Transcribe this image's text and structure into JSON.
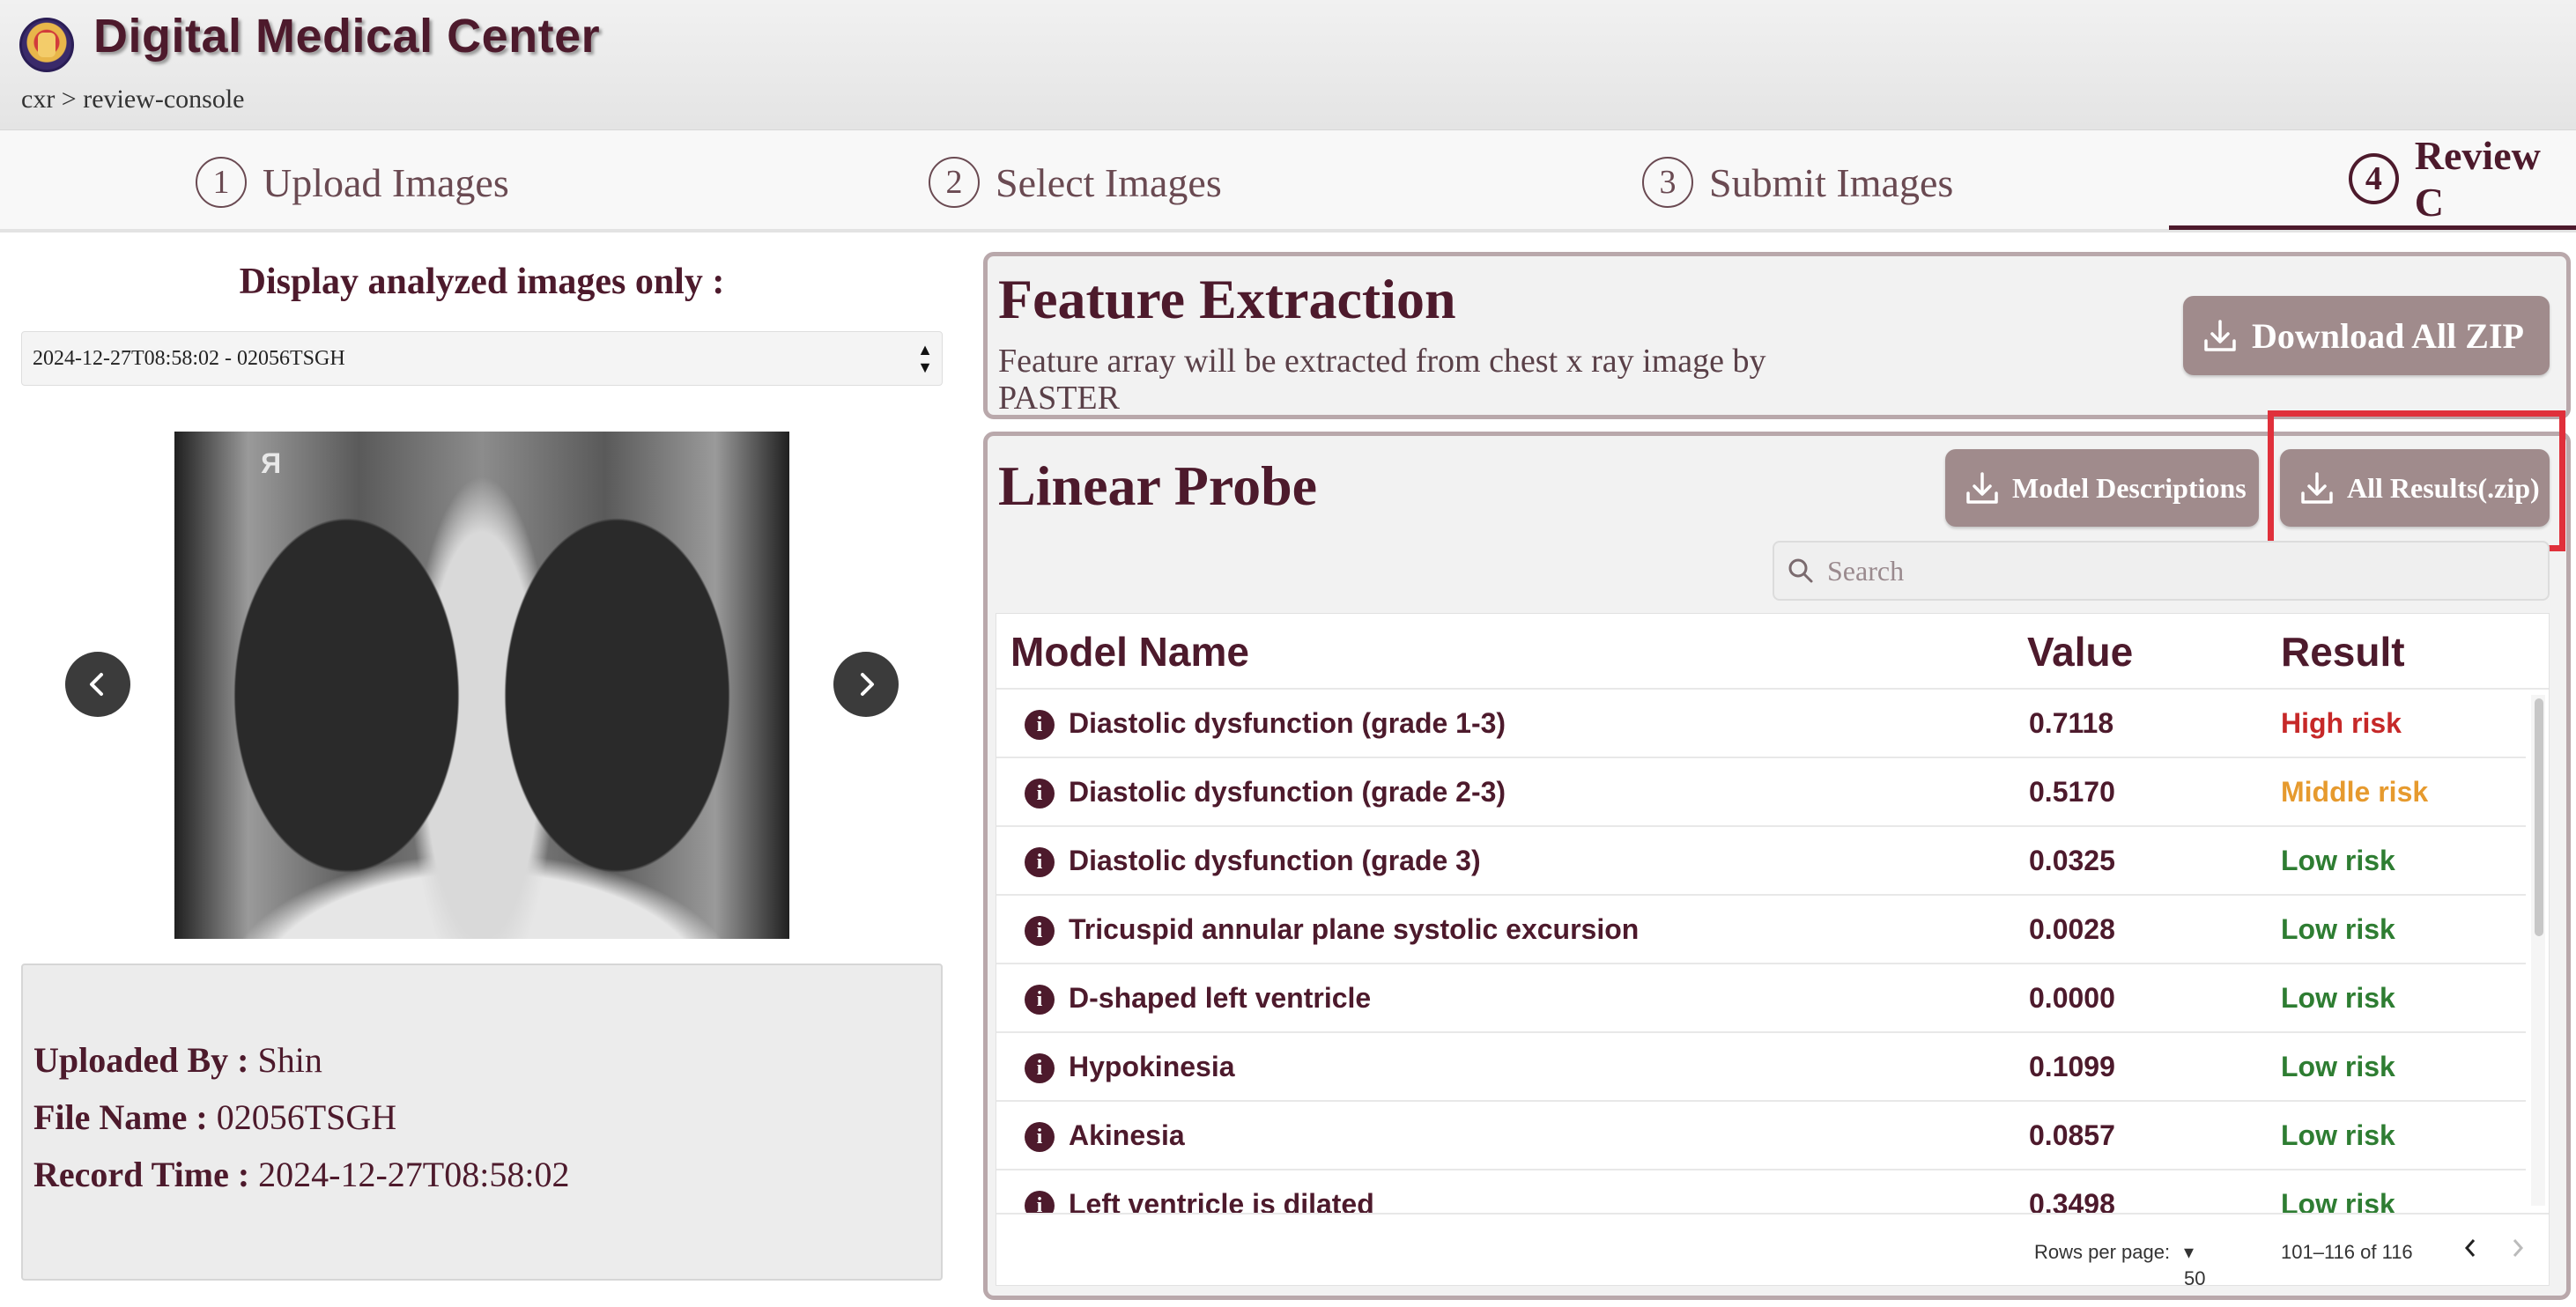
{
  "header": {
    "title": "Digital Medical Center",
    "breadcrumb": "cxr > review-console"
  },
  "stepper": {
    "steps": [
      {
        "num": "1",
        "label": "Upload Images"
      },
      {
        "num": "2",
        "label": "Select Images"
      },
      {
        "num": "3",
        "label": "Submit Images"
      },
      {
        "num": "4",
        "label": "Review C"
      }
    ],
    "active_step": 4
  },
  "left": {
    "filter_label": "Display analyzed images only :",
    "selected_record": "2024-12-27T08:58:02 - 02056TSGH",
    "image_marker": "R",
    "uploaded_by_label": "Uploaded By :",
    "uploaded_by": "Shin",
    "file_name_label": "File Name :",
    "file_name": "02056TSGH",
    "record_time_label": "Record Time :",
    "record_time": "2024-12-27T08:58:02"
  },
  "feature_extraction": {
    "title": "Feature Extraction",
    "description": "Feature array will be extracted from chest x ray image by PASTER",
    "download_button": "Download All ZIP"
  },
  "linear_probe": {
    "title": "Linear Probe",
    "model_descriptions_button": "Model Descriptions",
    "all_results_button": "All Results(.zip)",
    "search_placeholder": "Search",
    "columns": {
      "name": "Model Name",
      "value": "Value",
      "result": "Result"
    },
    "rows": [
      {
        "name": "Diastolic dysfunction (grade 1-3)",
        "value": "0.7118",
        "result": "High risk",
        "color": "#c62828"
      },
      {
        "name": "Diastolic dysfunction (grade 2-3)",
        "value": "0.5170",
        "result": "Middle risk",
        "color": "#e69a2e"
      },
      {
        "name": "Diastolic dysfunction (grade 3)",
        "value": "0.0325",
        "result": "Low risk",
        "color": "#2e7d32"
      },
      {
        "name": "Tricuspid annular plane systolic excursion",
        "value": "0.0028",
        "result": "Low risk",
        "color": "#2e7d32"
      },
      {
        "name": "D-shaped left ventricle",
        "value": "0.0000",
        "result": "Low risk",
        "color": "#2e7d32"
      },
      {
        "name": "Hypokinesia",
        "value": "0.1099",
        "result": "Low risk",
        "color": "#2e7d32"
      },
      {
        "name": "Akinesia",
        "value": "0.0857",
        "result": "Low risk",
        "color": "#2e7d32"
      },
      {
        "name": "Left ventricle is dilated",
        "value": "0.3498",
        "result": "Low risk",
        "color": "#2e7d32"
      }
    ],
    "pagination": {
      "rows_per_page_label": "Rows per page:",
      "rows_per_page": "50",
      "range": "101–116 of 116"
    }
  },
  "colors": {
    "brand": "#4d1a2c",
    "button": "#a08b8c",
    "highlight": "#e0303b"
  }
}
